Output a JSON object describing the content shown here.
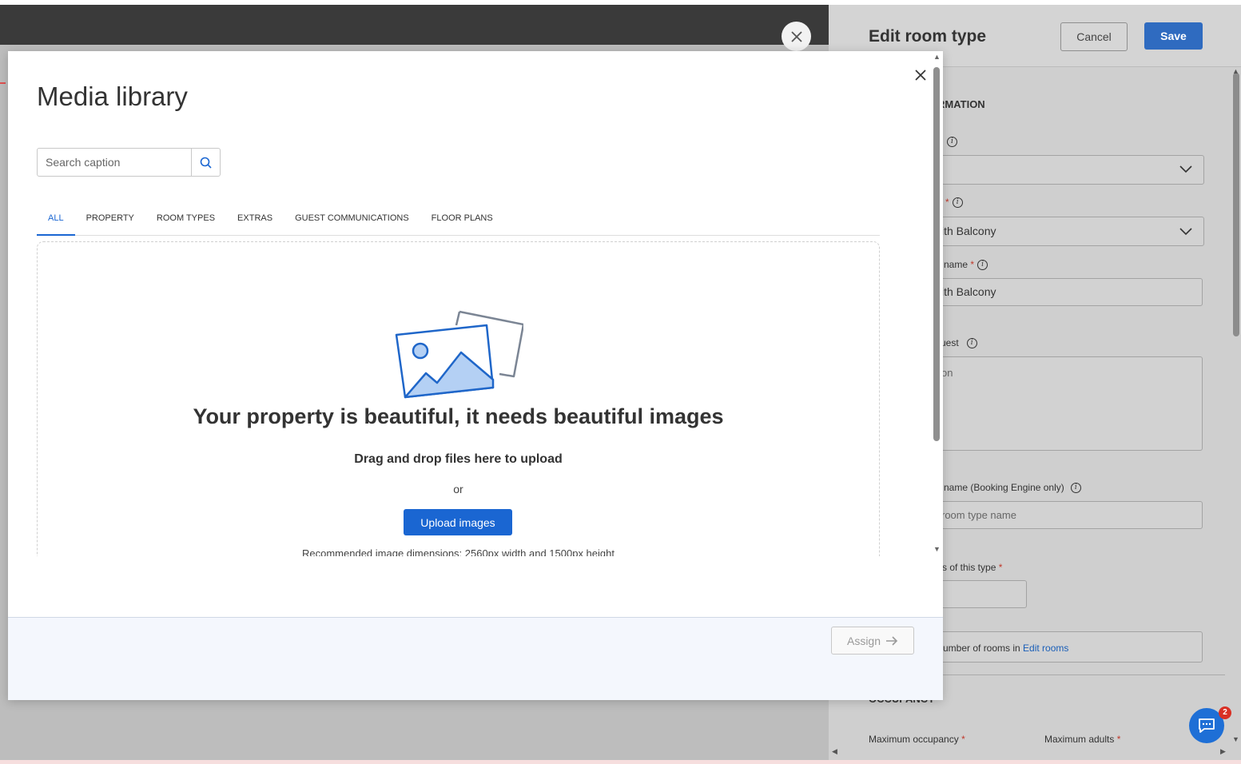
{
  "panel": {
    "title": "Edit room type",
    "cancel_label": "Cancel",
    "save_label": "Save",
    "section_info": "RMATION",
    "field1_value": "",
    "field2_label": "*",
    "field2_value": "ith Balcony",
    "field3_label": "e name",
    "field3_value": "ith Balcony",
    "field4_label": "uest",
    "field4_value": "on",
    "field5_label": "e name (Booking Engine only)",
    "field5_placeholder": "room type name",
    "field6_label": "s of this type",
    "rooms_note": "umber of rooms in",
    "rooms_link": "Edit rooms",
    "section_occupancy": "OCCUPANCY",
    "max_occupancy_label": "Maximum occupancy",
    "max_adults_label": "Maximum adults"
  },
  "chat": {
    "badge_count": "2"
  },
  "modal": {
    "title": "Media library",
    "search_placeholder": "Search caption",
    "tabs": [
      {
        "label": "ALL"
      },
      {
        "label": "PROPERTY"
      },
      {
        "label": "ROOM TYPES"
      },
      {
        "label": "EXTRAS"
      },
      {
        "label": "GUEST COMMUNICATIONS"
      },
      {
        "label": "FLOOR PLANS"
      }
    ],
    "active_tab": "ALL",
    "dropzone": {
      "heading": "Your property is beautiful, it needs beautiful images",
      "drag_text": "Drag and drop files here to upload",
      "or_text": "or",
      "upload_label": "Upload images",
      "recommend_text": "Recommended image dimensions: 2560px width and 1500px height"
    },
    "assign_label": "Assign"
  },
  "icons": {
    "close": "close-icon",
    "search": "search-icon",
    "info": "info-icon",
    "chevron": "chevron-down-icon",
    "arrow": "arrow-right-icon",
    "chat": "chat-icon",
    "image": "image-placeholder-icon"
  },
  "colors": {
    "accent": "#1a66d2",
    "save": "#2f6bc0",
    "badge": "#d93025"
  }
}
